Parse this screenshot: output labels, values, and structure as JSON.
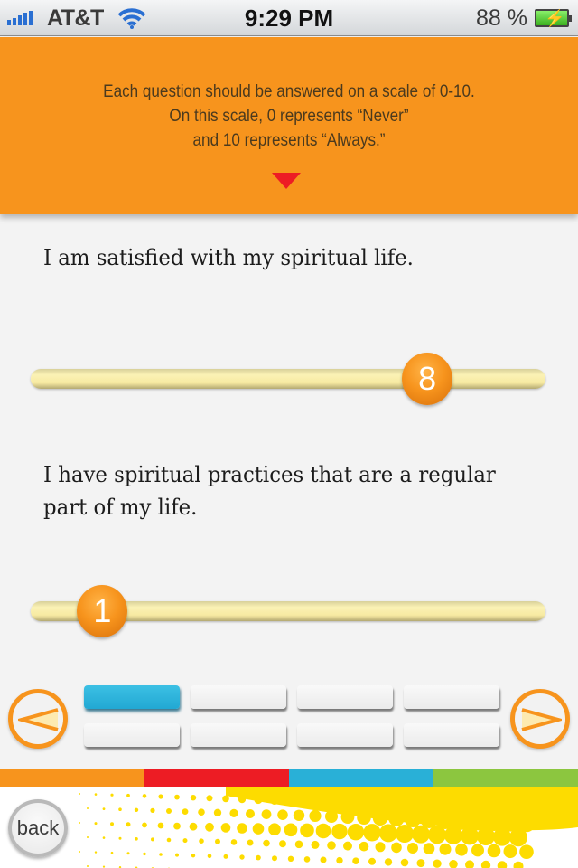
{
  "status_bar": {
    "carrier": "AT&T",
    "time": "9:29 PM",
    "battery_percent": "88 %",
    "signal_bars": 5,
    "wifi": true,
    "charging": true
  },
  "header": {
    "instructions": [
      "Each question should be answered on a scale of 0-10.",
      "On this scale, 0 represents “Never”",
      "and 10 represents “Always.”"
    ],
    "collapse_icon": "triangle-down-icon"
  },
  "questions": [
    {
      "text": "I am satisfied with my spiritual life.",
      "value": "8",
      "min": 0,
      "max": 10
    },
    {
      "text": "I have spiritual practices that are a regular part of my life.",
      "value": "1",
      "min": 0,
      "max": 10
    }
  ],
  "pagination": {
    "prev_icon": "chevron-left-icon",
    "next_icon": "chevron-right-icon",
    "total_pages": 8,
    "current_page": 1
  },
  "stripe_colors": [
    "#f7941d",
    "#ed1c24",
    "#29b0d7",
    "#8cc63f"
  ],
  "footer": {
    "back_label": "back",
    "accent_color": "#fddc00"
  },
  "colors": {
    "header_bg": "#f7941d",
    "thumb": "#f7941d",
    "active_page": "#29b0d7"
  }
}
